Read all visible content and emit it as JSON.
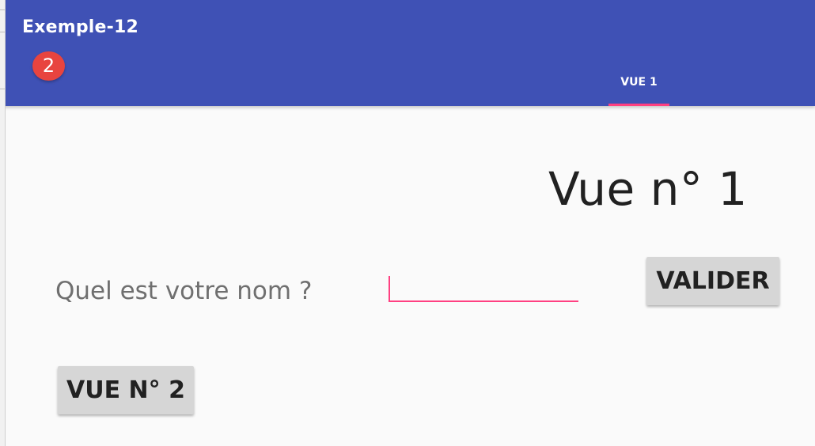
{
  "app_bar": {
    "title": "Exemple-12",
    "badge": "2",
    "color": "#3f51b5",
    "tabs": [
      {
        "label": "VUE 1",
        "selected": true
      }
    ],
    "indicator_color": "#ff4081"
  },
  "content": {
    "heading": "Vue n° 1",
    "prompt_label": "Quel est votre nom ?",
    "name_input": {
      "value": "",
      "placeholder": ""
    },
    "validate_button": "VALIDER",
    "view2_button": "VUE N° 2"
  }
}
